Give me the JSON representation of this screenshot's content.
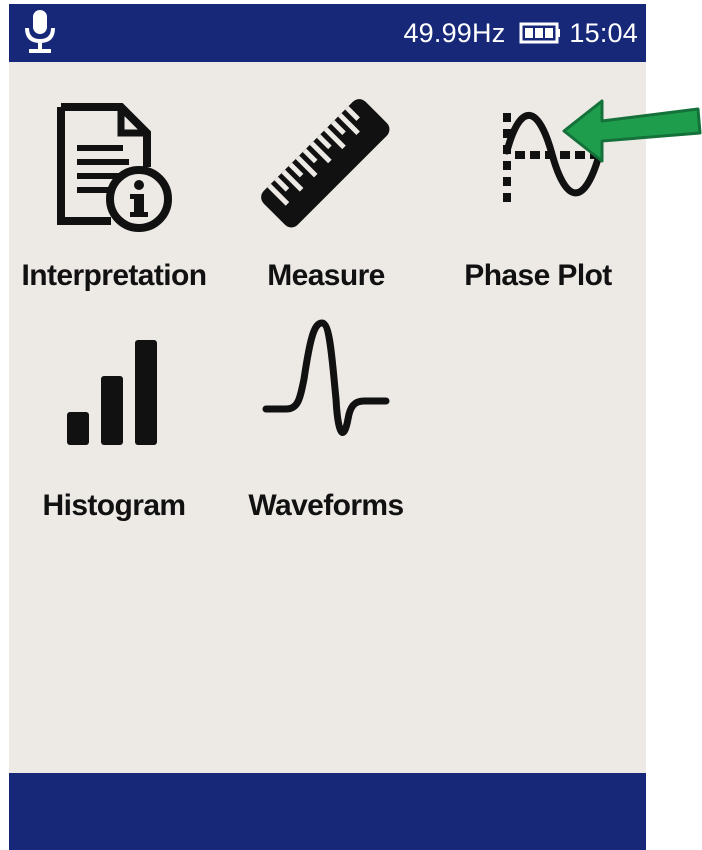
{
  "status_bar": {
    "frequency": "49.99Hz",
    "time": "15:04",
    "mic_icon": "microphone-icon",
    "battery_icon": "battery-icon"
  },
  "apps": [
    {
      "label": "Interpretation",
      "icon": "document-info-icon"
    },
    {
      "label": "Measure",
      "icon": "ruler-icon"
    },
    {
      "label": "Phase Plot",
      "icon": "sine-wave-icon"
    },
    {
      "label": "Histogram",
      "icon": "bar-chart-icon"
    },
    {
      "label": "Waveforms",
      "icon": "waveform-icon"
    }
  ],
  "colors": {
    "bar": "#172878",
    "background": "#ede9e5",
    "arrow": "#1e9e4c"
  }
}
